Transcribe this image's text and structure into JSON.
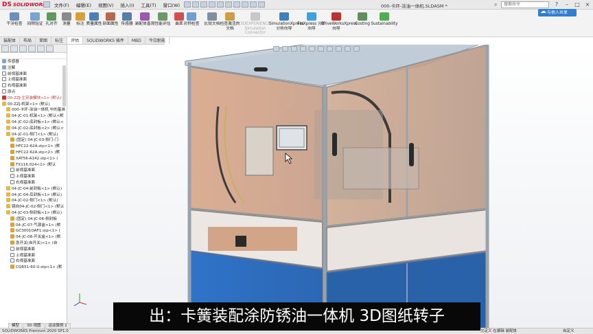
{
  "app": {
    "logo_ds": "DS",
    "logo_name": "SOLIDWORKS",
    "doc_title": "000-卡环-涂油一体机.SLDASM *",
    "search_placeholder": "搜索命令"
  },
  "menu": [
    "文件(F)",
    "编辑(E)",
    "视图(V)",
    "插入(I)",
    "工具(T)",
    "窗口(W)"
  ],
  "command_manager": [
    {
      "label": "干涉检查",
      "icon": "interference-icon",
      "color": "#6b8fbf"
    },
    {
      "label": "间隙验证",
      "icon": "clearance-icon",
      "color": "#7aa4d0"
    },
    {
      "label": "孔对齐",
      "icon": "hole-align-icon",
      "color": "#5e9a5e"
    },
    {
      "label": "测量",
      "icon": "measure-icon",
      "color": "#8a8a8a"
    },
    {
      "label": "标注",
      "icon": "markup-icon",
      "color": "#d9a03a"
    },
    {
      "label": "质量属性",
      "icon": "mass-properties-icon",
      "color": "#4f7fb5"
    },
    {
      "label": "剖面属性",
      "icon": "section-properties-icon",
      "color": "#b56a4f"
    },
    {
      "label": "传感器",
      "icon": "sensor-icon",
      "color": "#5a7da8"
    },
    {
      "label": "装配体直观",
      "icon": "assembly-visualization-icon",
      "color": "#9b5ab0"
    },
    {
      "label": "性能评估",
      "icon": "performance-icon",
      "color": "#6a9a6a"
    },
    {
      "label": "曲率",
      "icon": "curvature-icon",
      "color": "#d05050"
    },
    {
      "label": "对称检查",
      "icon": "symmetry-icon",
      "color": "#6f9fcf"
    },
    {
      "label": "比较文档",
      "icon": "compare-icon",
      "color": "#7f8f9f"
    },
    {
      "label": "检查激活的文档",
      "icon": "check-doc-icon",
      "color": "#cf9f3f"
    },
    {
      "label": "3DEXPERIENCE Simulation Connector",
      "icon": "3dx-icon",
      "color": "#c8c8c8",
      "disabled": true
    },
    {
      "label": "SimulationXpress 分析向导",
      "icon": "simxpress-icon",
      "color": "#3f7fbf"
    },
    {
      "label": "FloXpress 分析向导",
      "icon": "floxpress-icon",
      "color": "#3f9fdf"
    },
    {
      "label": "DriveWorksXpress 向导",
      "icon": "driveworks-icon",
      "color": "#c03030"
    },
    {
      "label": "Costing",
      "icon": "costing-icon",
      "color": "#5f8f5f"
    },
    {
      "label": "Sustainability",
      "icon": "sustainability-icon",
      "color": "#4faf4f"
    }
  ],
  "collab_button": "与他人共享",
  "tabs": [
    "装配体",
    "布局",
    "草图",
    "标注",
    "评估",
    "SOLIDWORKS 插件",
    "MBD",
    "今日耐能"
  ],
  "active_tab_index": 4,
  "tree": [
    {
      "label": "传感器",
      "icon": "sensor",
      "indent": 0
    },
    {
      "label": "注解",
      "icon": "sensor",
      "indent": 0
    },
    {
      "label": "前视基准面",
      "icon": "plane",
      "indent": 0
    },
    {
      "label": "上视基准面",
      "icon": "plane",
      "indent": 0
    },
    {
      "label": "右视基准面",
      "icon": "plane",
      "indent": 0
    },
    {
      "label": "原点",
      "icon": "plane",
      "indent": 0
    },
    {
      "label": "00-ZZJ-主安装模块<1> (默认)",
      "icon": "warn",
      "indent": 0,
      "color": "#c0392b"
    },
    {
      "label": "00-ZZJ-机架<1> (默认)",
      "icon": "asm",
      "indent": 0
    },
    {
      "label": "000-卡环-涂油一体机 中的基准",
      "icon": "asm",
      "indent": 1
    },
    {
      "label": "04-JC-01-机架<1> (默认<默",
      "icon": "asm",
      "indent": 1
    },
    {
      "label": "04-JC-02-底封板<1> (默认<",
      "icon": "asm",
      "indent": 1
    },
    {
      "label": "04-JC-02-底封板<2> (默认<",
      "icon": "asm",
      "indent": 1
    },
    {
      "label": "04-JC-01-侧门<1> (默认)",
      "icon": "asm",
      "indent": 1
    },
    {
      "label": "(固定) 04-JC-03-侧门-门",
      "icon": "part",
      "indent": 2
    },
    {
      "label": "HFC22-62A.stp<1> (默",
      "icon": "part",
      "indent": 2
    },
    {
      "label": "HFC22-62A.stp<2> (默",
      "icon": "part",
      "indent": 2
    },
    {
      "label": "XAT56-A142.stp<1> (",
      "icon": "part",
      "indent": 2
    },
    {
      "label": "TX116.024<1> (默认",
      "icon": "part",
      "indent": 2
    },
    {
      "label": "前视基准面",
      "icon": "plane",
      "indent": 2
    },
    {
      "label": "上视基准面",
      "icon": "plane",
      "indent": 2
    },
    {
      "label": "右视基准面",
      "icon": "plane",
      "indent": 2
    },
    {
      "label": "04-JC-04-前封板<1> (默认)",
      "icon": "asm",
      "indent": 1
    },
    {
      "label": "04-JC-04-后封板<1> (默认)",
      "icon": "asm",
      "indent": 1
    },
    {
      "label": "04-JC-02-侧门<1> (默认)",
      "icon": "asm",
      "indent": 1
    },
    {
      "label": "镜向04-JC-02-侧门<1> (默认",
      "icon": "asm",
      "indent": 1
    },
    {
      "label": "04-JC-03-侧封板<1> (默认)",
      "icon": "asm",
      "indent": 1
    },
    {
      "label": "(固定) 04-JC-06-侧封板",
      "icon": "part",
      "indent": 2
    },
    {
      "label": "04-JC-07-气源盒<1> (默",
      "icon": "part",
      "indent": 2
    },
    {
      "label": "GC3001OAF1.stp<1> (",
      "icon": "part",
      "indent": 2
    },
    {
      "label": "04-JC-08-开关盒<1> (默",
      "icon": "part",
      "indent": 2
    },
    {
      "label": "急开关(自开关)<1> (自",
      "icon": "part",
      "indent": 2
    },
    {
      "label": "前视基准面",
      "icon": "plane",
      "indent": 2
    },
    {
      "label": "上视基准面",
      "icon": "plane",
      "indent": 2
    },
    {
      "label": "右视基准面",
      "icon": "plane",
      "indent": 2
    },
    {
      "label": "CGR51-60-U.stp<1> (默",
      "icon": "part",
      "indent": 2
    }
  ],
  "bottom_tabs": [
    "模型",
    "3D 视图",
    "运动算例 1"
  ],
  "status": {
    "left": "SOLIDWORKS Premium 2020 SP1.0",
    "right": "欠定义  在编辑 装配体",
    "units": "自定义"
  },
  "caption": "出：卡簧装配涂防锈油一体机 3D图纸转子"
}
